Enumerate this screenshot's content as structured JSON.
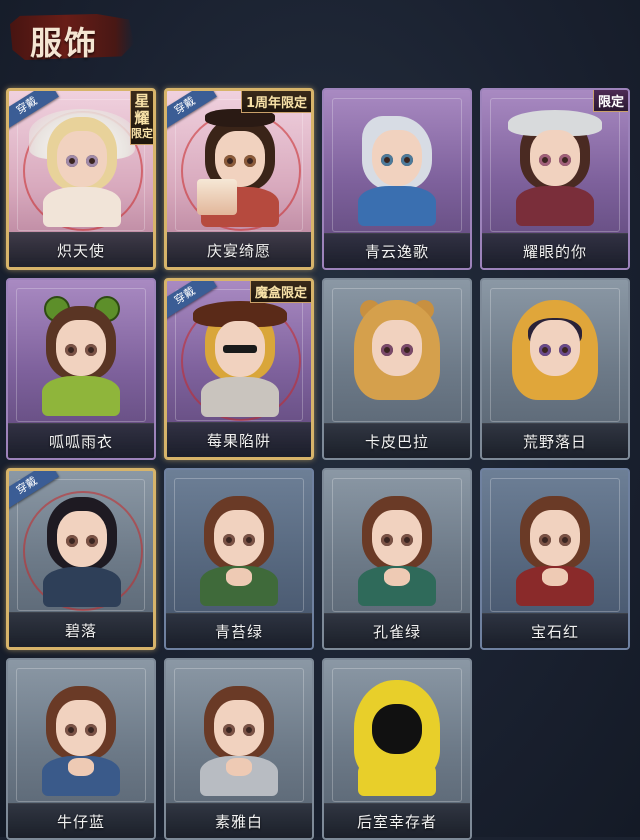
{
  "page": {
    "title": "服饰"
  },
  "badges": {
    "wear": "穿戴"
  },
  "colors": {
    "accent_gold": "#d7b46a",
    "wear_badge": "#3b5d95",
    "title_brush": "#6c1d16"
  },
  "costumes": [
    {
      "name": "炽天使",
      "rarity": "pink",
      "equipped": true,
      "tag_vertical_big": "星耀",
      "tag_vertical_small": "限定",
      "icon": "seraph-portrait-icon"
    },
    {
      "name": "庆宴绮愿",
      "rarity": "pink",
      "equipped": true,
      "tag": "1周年限定",
      "icon": "birthday-portrait-icon"
    },
    {
      "name": "青云逸歌",
      "rarity": "purple",
      "equipped": false,
      "icon": "silver-hair-portrait-icon"
    },
    {
      "name": "耀眼的你",
      "rarity": "purple",
      "equipped": false,
      "tag": "限定",
      "icon": "cowboy-hat-portrait-icon"
    },
    {
      "name": "呱呱雨衣",
      "rarity": "purple",
      "equipped": false,
      "icon": "frog-raincoat-portrait-icon"
    },
    {
      "name": "莓果陷阱",
      "rarity": "purple",
      "equipped": true,
      "tag": "魔盒限定",
      "icon": "berry-hat-portrait-icon"
    },
    {
      "name": "卡皮巴拉",
      "rarity": "gray",
      "equipped": false,
      "icon": "capybara-hood-portrait-icon"
    },
    {
      "name": "荒野落日",
      "rarity": "gray",
      "equipped": false,
      "icon": "yellow-hood-portrait-icon"
    },
    {
      "name": "碧落",
      "rarity": "gray",
      "equipped": true,
      "icon": "dark-hair-portrait-icon"
    },
    {
      "name": "青苔绿",
      "rarity": "blue",
      "equipped": false,
      "icon": "green-coat-portrait-icon"
    },
    {
      "name": "孔雀绿",
      "rarity": "gray",
      "equipped": false,
      "icon": "peacock-coat-portrait-icon"
    },
    {
      "name": "宝石红",
      "rarity": "blue",
      "equipped": false,
      "icon": "red-coat-portrait-icon"
    },
    {
      "name": "牛仔蓝",
      "rarity": "gray",
      "equipped": false,
      "icon": "denim-coat-portrait-icon"
    },
    {
      "name": "素雅白",
      "rarity": "gray",
      "equipped": false,
      "icon": "white-coat-portrait-icon"
    },
    {
      "name": "后室幸存者",
      "rarity": "gray",
      "equipped": false,
      "icon": "hazmat-portrait-icon"
    }
  ]
}
